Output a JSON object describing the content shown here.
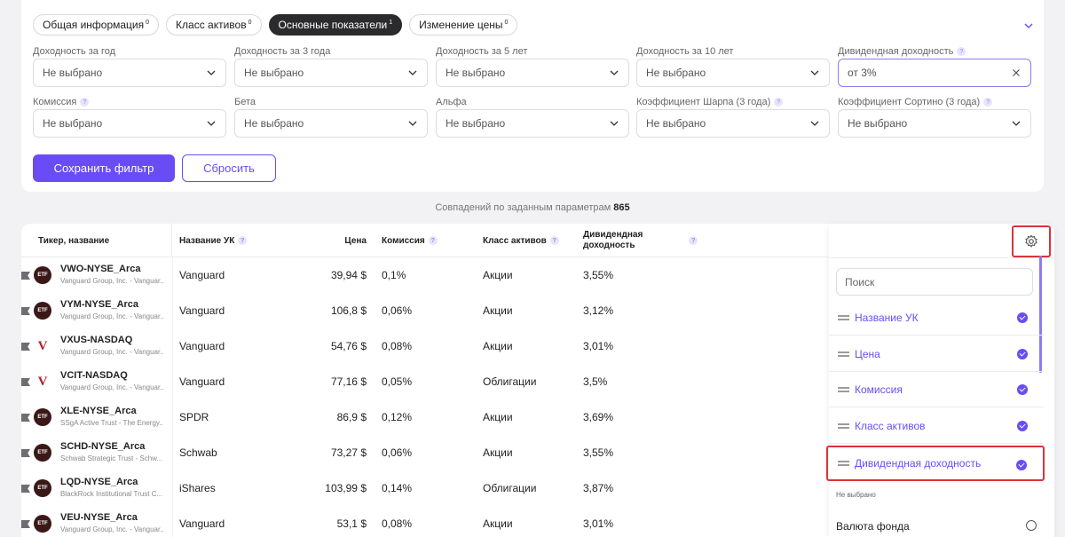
{
  "tabs": [
    {
      "label": "Общая информация",
      "count": "0"
    },
    {
      "label": "Класс активов",
      "count": "0"
    },
    {
      "label": "Основные показатели",
      "count": "1",
      "active": true
    },
    {
      "label": "Изменение цены",
      "count": "0"
    }
  ],
  "filters": {
    "row1": [
      {
        "label": "Доходность за год",
        "value": "Не выбрано"
      },
      {
        "label": "Доходность за 3 года",
        "value": "Не выбрано"
      },
      {
        "label": "Доходность за 5 лет",
        "value": "Не выбрано"
      },
      {
        "label": "Доходность за 10 лет",
        "value": "Не выбрано"
      },
      {
        "label": "Дивидендная доходность",
        "value": "от 3%"
      }
    ],
    "row2": [
      {
        "label": "Комиссия",
        "value": "Не выбрано"
      },
      {
        "label": "Бета",
        "value": "Не выбрано"
      },
      {
        "label": "Альфа",
        "value": "Не выбрано"
      },
      {
        "label": "Коэффициент Шарпа (3 года)",
        "value": "Не выбрано"
      },
      {
        "label": "Коэффициент Сортино (3 года)",
        "value": "Не выбрано"
      }
    ]
  },
  "buttons": {
    "save": "Сохранить фильтр",
    "reset": "Сбросить"
  },
  "matches": {
    "text": "Совпадений по заданным параметрам",
    "count": "865"
  },
  "table": {
    "headers": {
      "ticker": "Тикер, название",
      "uk": "Название УК",
      "price": "Цена",
      "fee": "Комиссия",
      "asset_class": "Класс активов",
      "div_line1": "Дивидендная",
      "div_line2": "доходность"
    },
    "rows": [
      {
        "ticker": "VWO-NYSE_Arca",
        "name": "Vanguard Group, Inc. - Vanguar...",
        "uk": "Vanguard",
        "price": "39,94 $",
        "fee": "0,1%",
        "cls": "Акции",
        "div": "3,55%",
        "logo": "ETF"
      },
      {
        "ticker": "VYM-NYSE_Arca",
        "name": "Vanguard Group, Inc. - Vanguar...",
        "uk": "Vanguard",
        "price": "106,8 $",
        "fee": "0,06%",
        "cls": "Акции",
        "div": "3,12%",
        "logo": "ETF"
      },
      {
        "ticker": "VXUS-NASDAQ",
        "name": "Vanguard Group, Inc. - Vanguar...",
        "uk": "Vanguard",
        "price": "54,76 $",
        "fee": "0,08%",
        "cls": "Акции",
        "div": "3,01%",
        "logo": "V"
      },
      {
        "ticker": "VCIT-NASDAQ",
        "name": "Vanguard Group, Inc. - Vanguar...",
        "uk": "Vanguard",
        "price": "77,16 $",
        "fee": "0,05%",
        "cls": "Облигации",
        "div": "3,5%",
        "logo": "V"
      },
      {
        "ticker": "XLE-NYSE_Arca",
        "name": "SSgA Active Trust - The Energy...",
        "uk": "SPDR",
        "price": "86,9 $",
        "fee": "0,12%",
        "cls": "Акции",
        "div": "3,69%",
        "logo": "ETF"
      },
      {
        "ticker": "SCHD-NYSE_Arca",
        "name": "Schwab Strategic Trust - Schw...",
        "uk": "Schwab",
        "price": "73,27 $",
        "fee": "0,06%",
        "cls": "Акции",
        "div": "3,55%",
        "logo": "ETF"
      },
      {
        "ticker": "LQD-NYSE_Arca",
        "name": "BlackRock Institutional Trust C...",
        "uk": "iShares",
        "price": "103,99 $",
        "fee": "0,14%",
        "cls": "Облигации",
        "div": "3,87%",
        "logo": "ETF"
      },
      {
        "ticker": "VEU-NYSE_Arca",
        "name": "Vanguard Group, Inc. - Vanguar...",
        "uk": "Vanguard",
        "price": "53,1 $",
        "fee": "0,08%",
        "cls": "Акции",
        "div": "3,01%",
        "logo": "ETF"
      }
    ]
  },
  "panel": {
    "search_placeholder": "Поиск",
    "items": [
      "Название УК",
      "Цена",
      "Комиссия",
      "Класс активов",
      "Дивидендная доходность"
    ],
    "not_selected_label": "Не выбрано",
    "unselected_item": "Валюта фонда"
  },
  "colors": {
    "accent": "#6a4cf5",
    "highlight": "#d8343b"
  }
}
